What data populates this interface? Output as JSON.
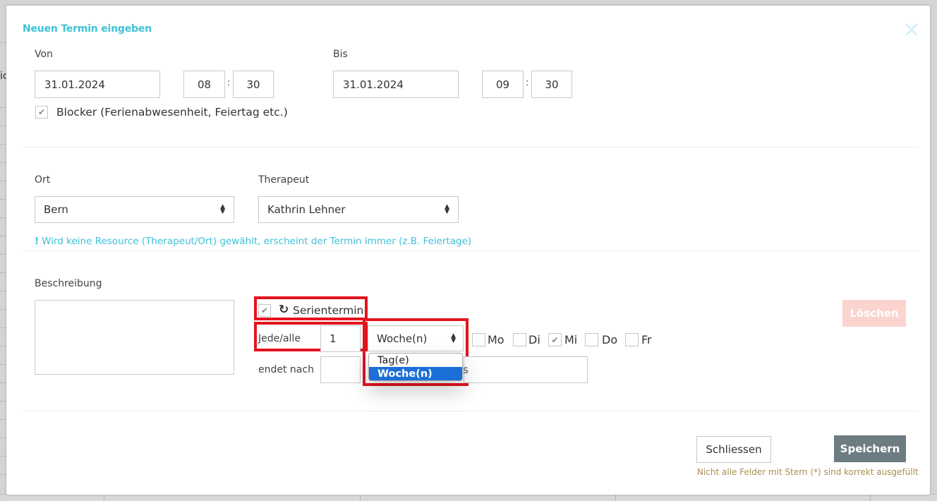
{
  "background": {
    "edge_text": "ic"
  },
  "modal": {
    "title": "Neuen Termin eingeben",
    "close_symbol": "✕",
    "von": {
      "label": "Von",
      "date": "31.01.2024",
      "hour": "08",
      "minute": "30"
    },
    "bis": {
      "label": "Bis",
      "date": "31.01.2024",
      "hour": "09",
      "minute": "30"
    },
    "time_separator": ":",
    "blocker": {
      "label": "Blocker (Ferienabwesenheit, Feiertag etc.)",
      "checked": true
    },
    "ort": {
      "label": "Ort",
      "value": "Bern"
    },
    "therapeut": {
      "label": "Therapeut",
      "value": "Kathrin Lehner"
    },
    "hint": {
      "mark": "!",
      "text": "Wird keine Resource (Therapeut/Ort) gewählt, erscheint der Termin immer (z.B. Feiertage)"
    },
    "beschreibung": {
      "label": "Beschreibung",
      "value": ""
    },
    "serie": {
      "label": "Serientermin",
      "checked": true,
      "jede_label": "Jede/alle",
      "interval": "1",
      "unit_selected": "Woche(n)",
      "unit_options": [
        "Tag(e)",
        "Woche(n)"
      ],
      "days": [
        {
          "label": "Mo",
          "checked": false
        },
        {
          "label": "Di",
          "checked": false
        },
        {
          "label": "Mi",
          "checked": true
        },
        {
          "label": "Do",
          "checked": false
        },
        {
          "label": "Fr",
          "checked": false
        }
      ],
      "endet_label": "endet nach",
      "endet_value": "",
      "endet_suffix_visible": "s",
      "endet_date": ""
    },
    "buttons": {
      "loeschen": "Löschen",
      "schliessen": "Schliessen",
      "speichern": "Speichern"
    },
    "footnote": "Nicht alle Felder mit Stern (*) sind korrekt ausgefüllt"
  },
  "colors": {
    "accent": "#3fc1d6",
    "highlight_red": "#e3141f",
    "speichern_bg": "#6d7c80",
    "loeschen_bg": "#fbd4cf",
    "footnote": "#a88f4e",
    "option_selected": "#1c6fd6"
  },
  "icons": {
    "check": "check-icon",
    "refresh": "refresh-icon",
    "sort": "sort-arrows-icon",
    "close": "close-icon"
  }
}
